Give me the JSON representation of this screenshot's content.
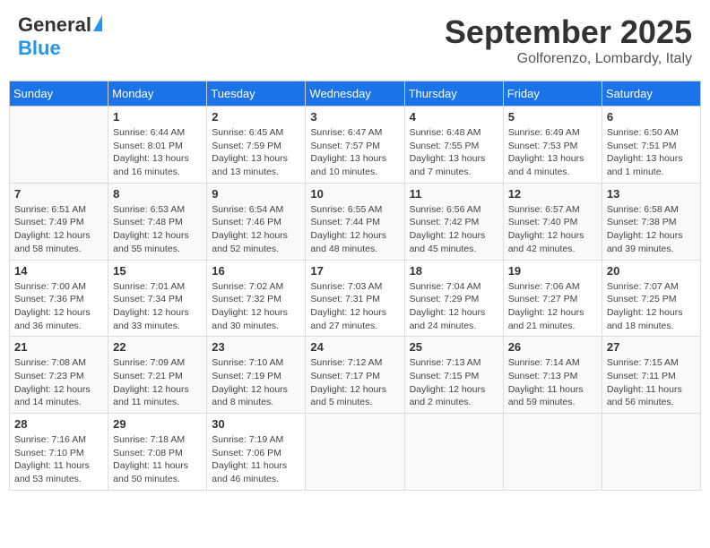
{
  "header": {
    "logo_general": "General",
    "logo_blue": "Blue",
    "month_title": "September 2025",
    "location": "Golforenzo, Lombardy, Italy"
  },
  "weekdays": [
    "Sunday",
    "Monday",
    "Tuesday",
    "Wednesday",
    "Thursday",
    "Friday",
    "Saturday"
  ],
  "weeks": [
    [
      {
        "day": "",
        "info": ""
      },
      {
        "day": "1",
        "info": "Sunrise: 6:44 AM\nSunset: 8:01 PM\nDaylight: 13 hours\nand 16 minutes."
      },
      {
        "day": "2",
        "info": "Sunrise: 6:45 AM\nSunset: 7:59 PM\nDaylight: 13 hours\nand 13 minutes."
      },
      {
        "day": "3",
        "info": "Sunrise: 6:47 AM\nSunset: 7:57 PM\nDaylight: 13 hours\nand 10 minutes."
      },
      {
        "day": "4",
        "info": "Sunrise: 6:48 AM\nSunset: 7:55 PM\nDaylight: 13 hours\nand 7 minutes."
      },
      {
        "day": "5",
        "info": "Sunrise: 6:49 AM\nSunset: 7:53 PM\nDaylight: 13 hours\nand 4 minutes."
      },
      {
        "day": "6",
        "info": "Sunrise: 6:50 AM\nSunset: 7:51 PM\nDaylight: 13 hours\nand 1 minute."
      }
    ],
    [
      {
        "day": "7",
        "info": "Sunrise: 6:51 AM\nSunset: 7:49 PM\nDaylight: 12 hours\nand 58 minutes."
      },
      {
        "day": "8",
        "info": "Sunrise: 6:53 AM\nSunset: 7:48 PM\nDaylight: 12 hours\nand 55 minutes."
      },
      {
        "day": "9",
        "info": "Sunrise: 6:54 AM\nSunset: 7:46 PM\nDaylight: 12 hours\nand 52 minutes."
      },
      {
        "day": "10",
        "info": "Sunrise: 6:55 AM\nSunset: 7:44 PM\nDaylight: 12 hours\nand 48 minutes."
      },
      {
        "day": "11",
        "info": "Sunrise: 6:56 AM\nSunset: 7:42 PM\nDaylight: 12 hours\nand 45 minutes."
      },
      {
        "day": "12",
        "info": "Sunrise: 6:57 AM\nSunset: 7:40 PM\nDaylight: 12 hours\nand 42 minutes."
      },
      {
        "day": "13",
        "info": "Sunrise: 6:58 AM\nSunset: 7:38 PM\nDaylight: 12 hours\nand 39 minutes."
      }
    ],
    [
      {
        "day": "14",
        "info": "Sunrise: 7:00 AM\nSunset: 7:36 PM\nDaylight: 12 hours\nand 36 minutes."
      },
      {
        "day": "15",
        "info": "Sunrise: 7:01 AM\nSunset: 7:34 PM\nDaylight: 12 hours\nand 33 minutes."
      },
      {
        "day": "16",
        "info": "Sunrise: 7:02 AM\nSunset: 7:32 PM\nDaylight: 12 hours\nand 30 minutes."
      },
      {
        "day": "17",
        "info": "Sunrise: 7:03 AM\nSunset: 7:31 PM\nDaylight: 12 hours\nand 27 minutes."
      },
      {
        "day": "18",
        "info": "Sunrise: 7:04 AM\nSunset: 7:29 PM\nDaylight: 12 hours\nand 24 minutes."
      },
      {
        "day": "19",
        "info": "Sunrise: 7:06 AM\nSunset: 7:27 PM\nDaylight: 12 hours\nand 21 minutes."
      },
      {
        "day": "20",
        "info": "Sunrise: 7:07 AM\nSunset: 7:25 PM\nDaylight: 12 hours\nand 18 minutes."
      }
    ],
    [
      {
        "day": "21",
        "info": "Sunrise: 7:08 AM\nSunset: 7:23 PM\nDaylight: 12 hours\nand 14 minutes."
      },
      {
        "day": "22",
        "info": "Sunrise: 7:09 AM\nSunset: 7:21 PM\nDaylight: 12 hours\nand 11 minutes."
      },
      {
        "day": "23",
        "info": "Sunrise: 7:10 AM\nSunset: 7:19 PM\nDaylight: 12 hours\nand 8 minutes."
      },
      {
        "day": "24",
        "info": "Sunrise: 7:12 AM\nSunset: 7:17 PM\nDaylight: 12 hours\nand 5 minutes."
      },
      {
        "day": "25",
        "info": "Sunrise: 7:13 AM\nSunset: 7:15 PM\nDaylight: 12 hours\nand 2 minutes."
      },
      {
        "day": "26",
        "info": "Sunrise: 7:14 AM\nSunset: 7:13 PM\nDaylight: 11 hours\nand 59 minutes."
      },
      {
        "day": "27",
        "info": "Sunrise: 7:15 AM\nSunset: 7:11 PM\nDaylight: 11 hours\nand 56 minutes."
      }
    ],
    [
      {
        "day": "28",
        "info": "Sunrise: 7:16 AM\nSunset: 7:10 PM\nDaylight: 11 hours\nand 53 minutes."
      },
      {
        "day": "29",
        "info": "Sunrise: 7:18 AM\nSunset: 7:08 PM\nDaylight: 11 hours\nand 50 minutes."
      },
      {
        "day": "30",
        "info": "Sunrise: 7:19 AM\nSunset: 7:06 PM\nDaylight: 11 hours\nand 46 minutes."
      },
      {
        "day": "",
        "info": ""
      },
      {
        "day": "",
        "info": ""
      },
      {
        "day": "",
        "info": ""
      },
      {
        "day": "",
        "info": ""
      }
    ]
  ]
}
